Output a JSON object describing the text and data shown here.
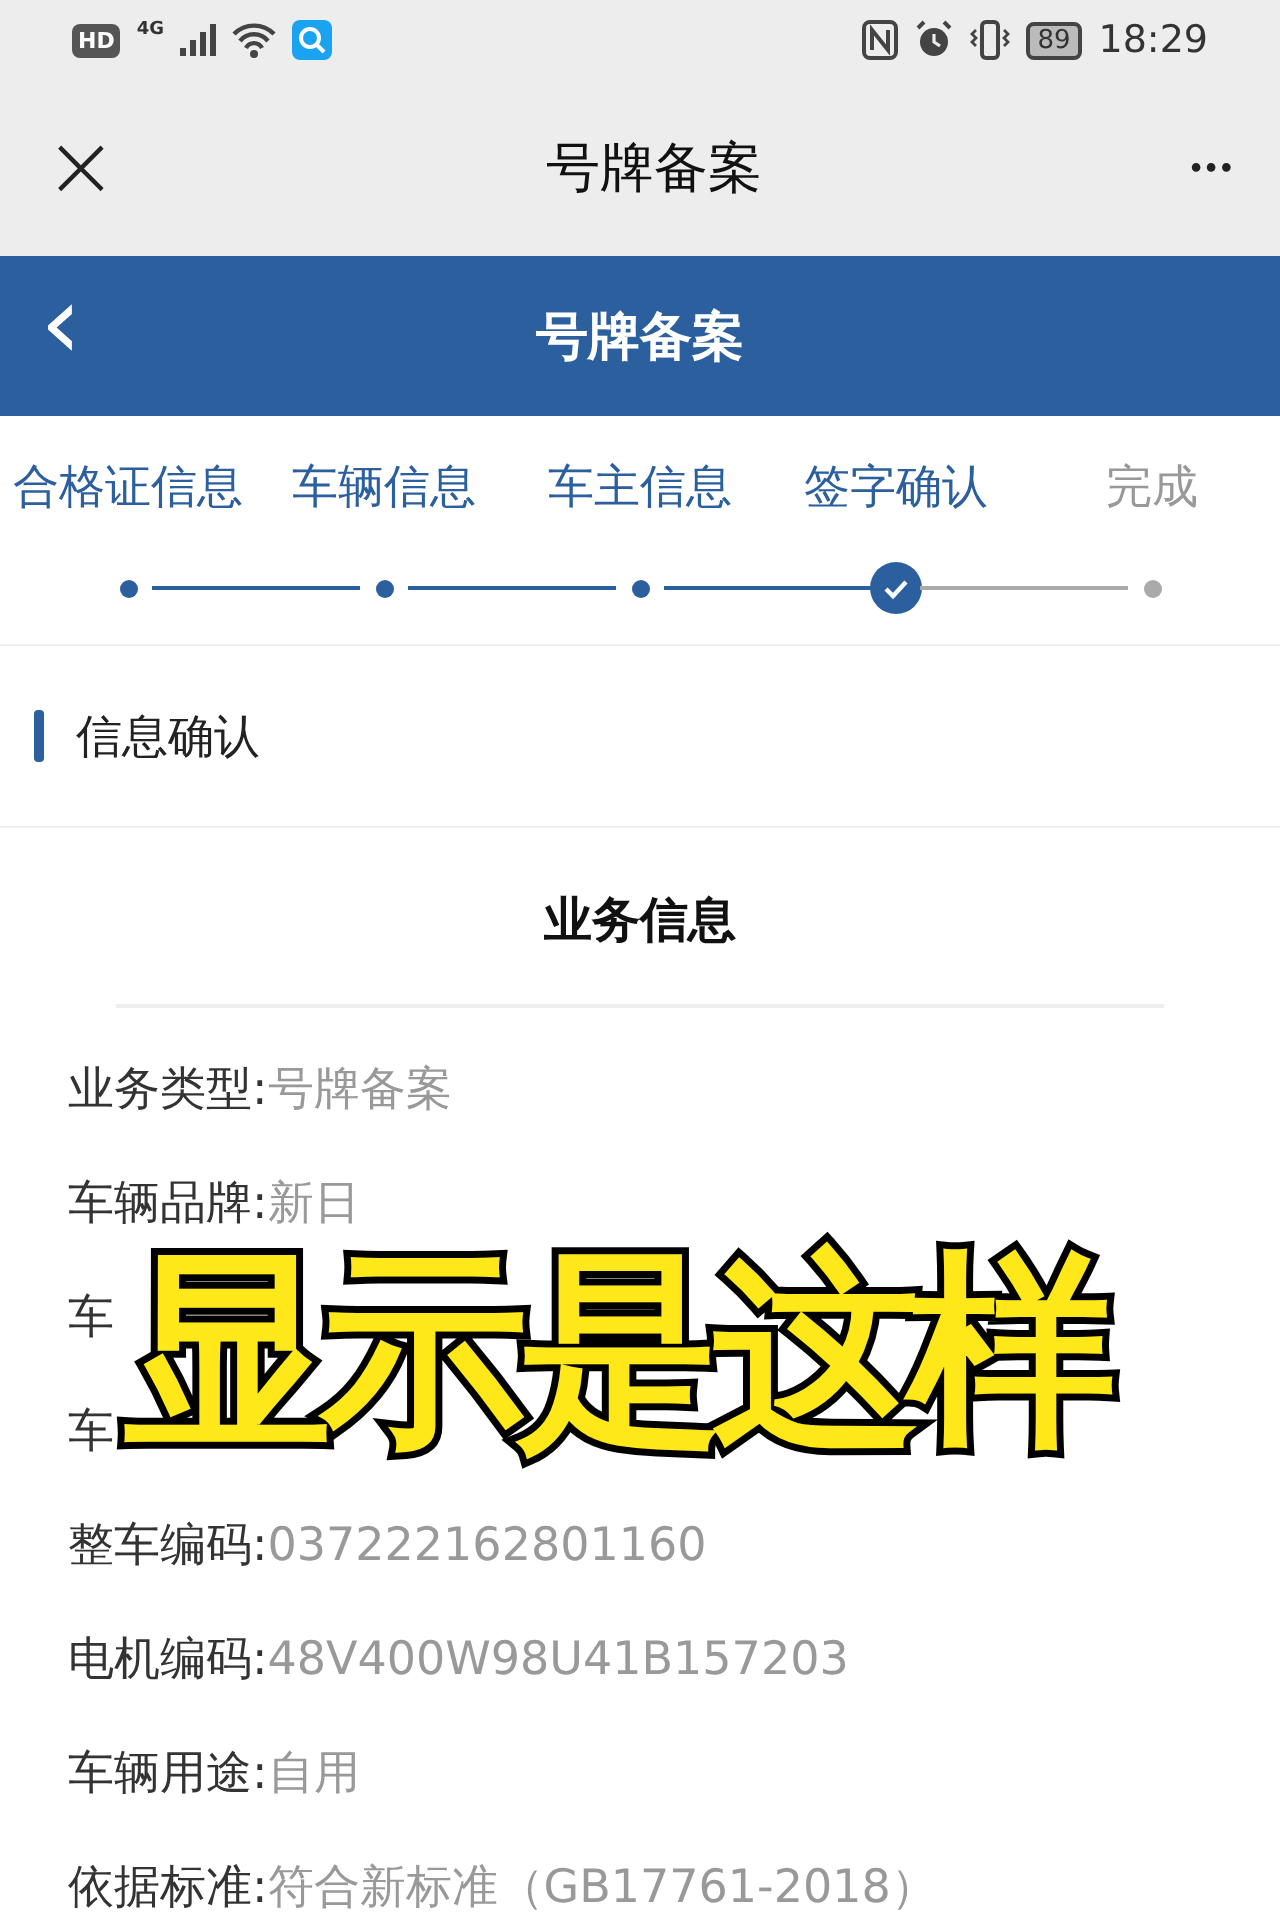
{
  "status_bar": {
    "hd": "HD",
    "network": "4G",
    "battery": "89",
    "time": "18:29"
  },
  "title_bar": {
    "close": "×",
    "title": "号牌备案",
    "more": "•••"
  },
  "header": {
    "back": "‹",
    "title": "号牌备案"
  },
  "steps": [
    {
      "label": "合格证信息",
      "completed": true,
      "selected": false
    },
    {
      "label": "车辆信息",
      "completed": true,
      "selected": false
    },
    {
      "label": "车主信息",
      "completed": true,
      "selected": false
    },
    {
      "label": "签字确认",
      "completed": false,
      "selected": true
    },
    {
      "label": "完成",
      "completed": false,
      "selected": false
    }
  ],
  "section": {
    "title": "信息确认"
  },
  "card": {
    "title": "业务信息",
    "rows": [
      {
        "label": "业务类型:",
        "value": "号牌备案"
      },
      {
        "label": "车辆品牌:",
        "value": "新日"
      },
      {
        "label": "车"
      },
      {
        "label": "车"
      },
      {
        "label": "整车编码:",
        "value": "037222162801160"
      },
      {
        "label": "电机编码:",
        "value": "48V400W98U41B157203"
      },
      {
        "label": "车辆用途:",
        "value": "自用"
      },
      {
        "label": "依据标准:",
        "value": "符合新标准（GB17761-2018）"
      }
    ]
  },
  "caption": "显示是这样"
}
